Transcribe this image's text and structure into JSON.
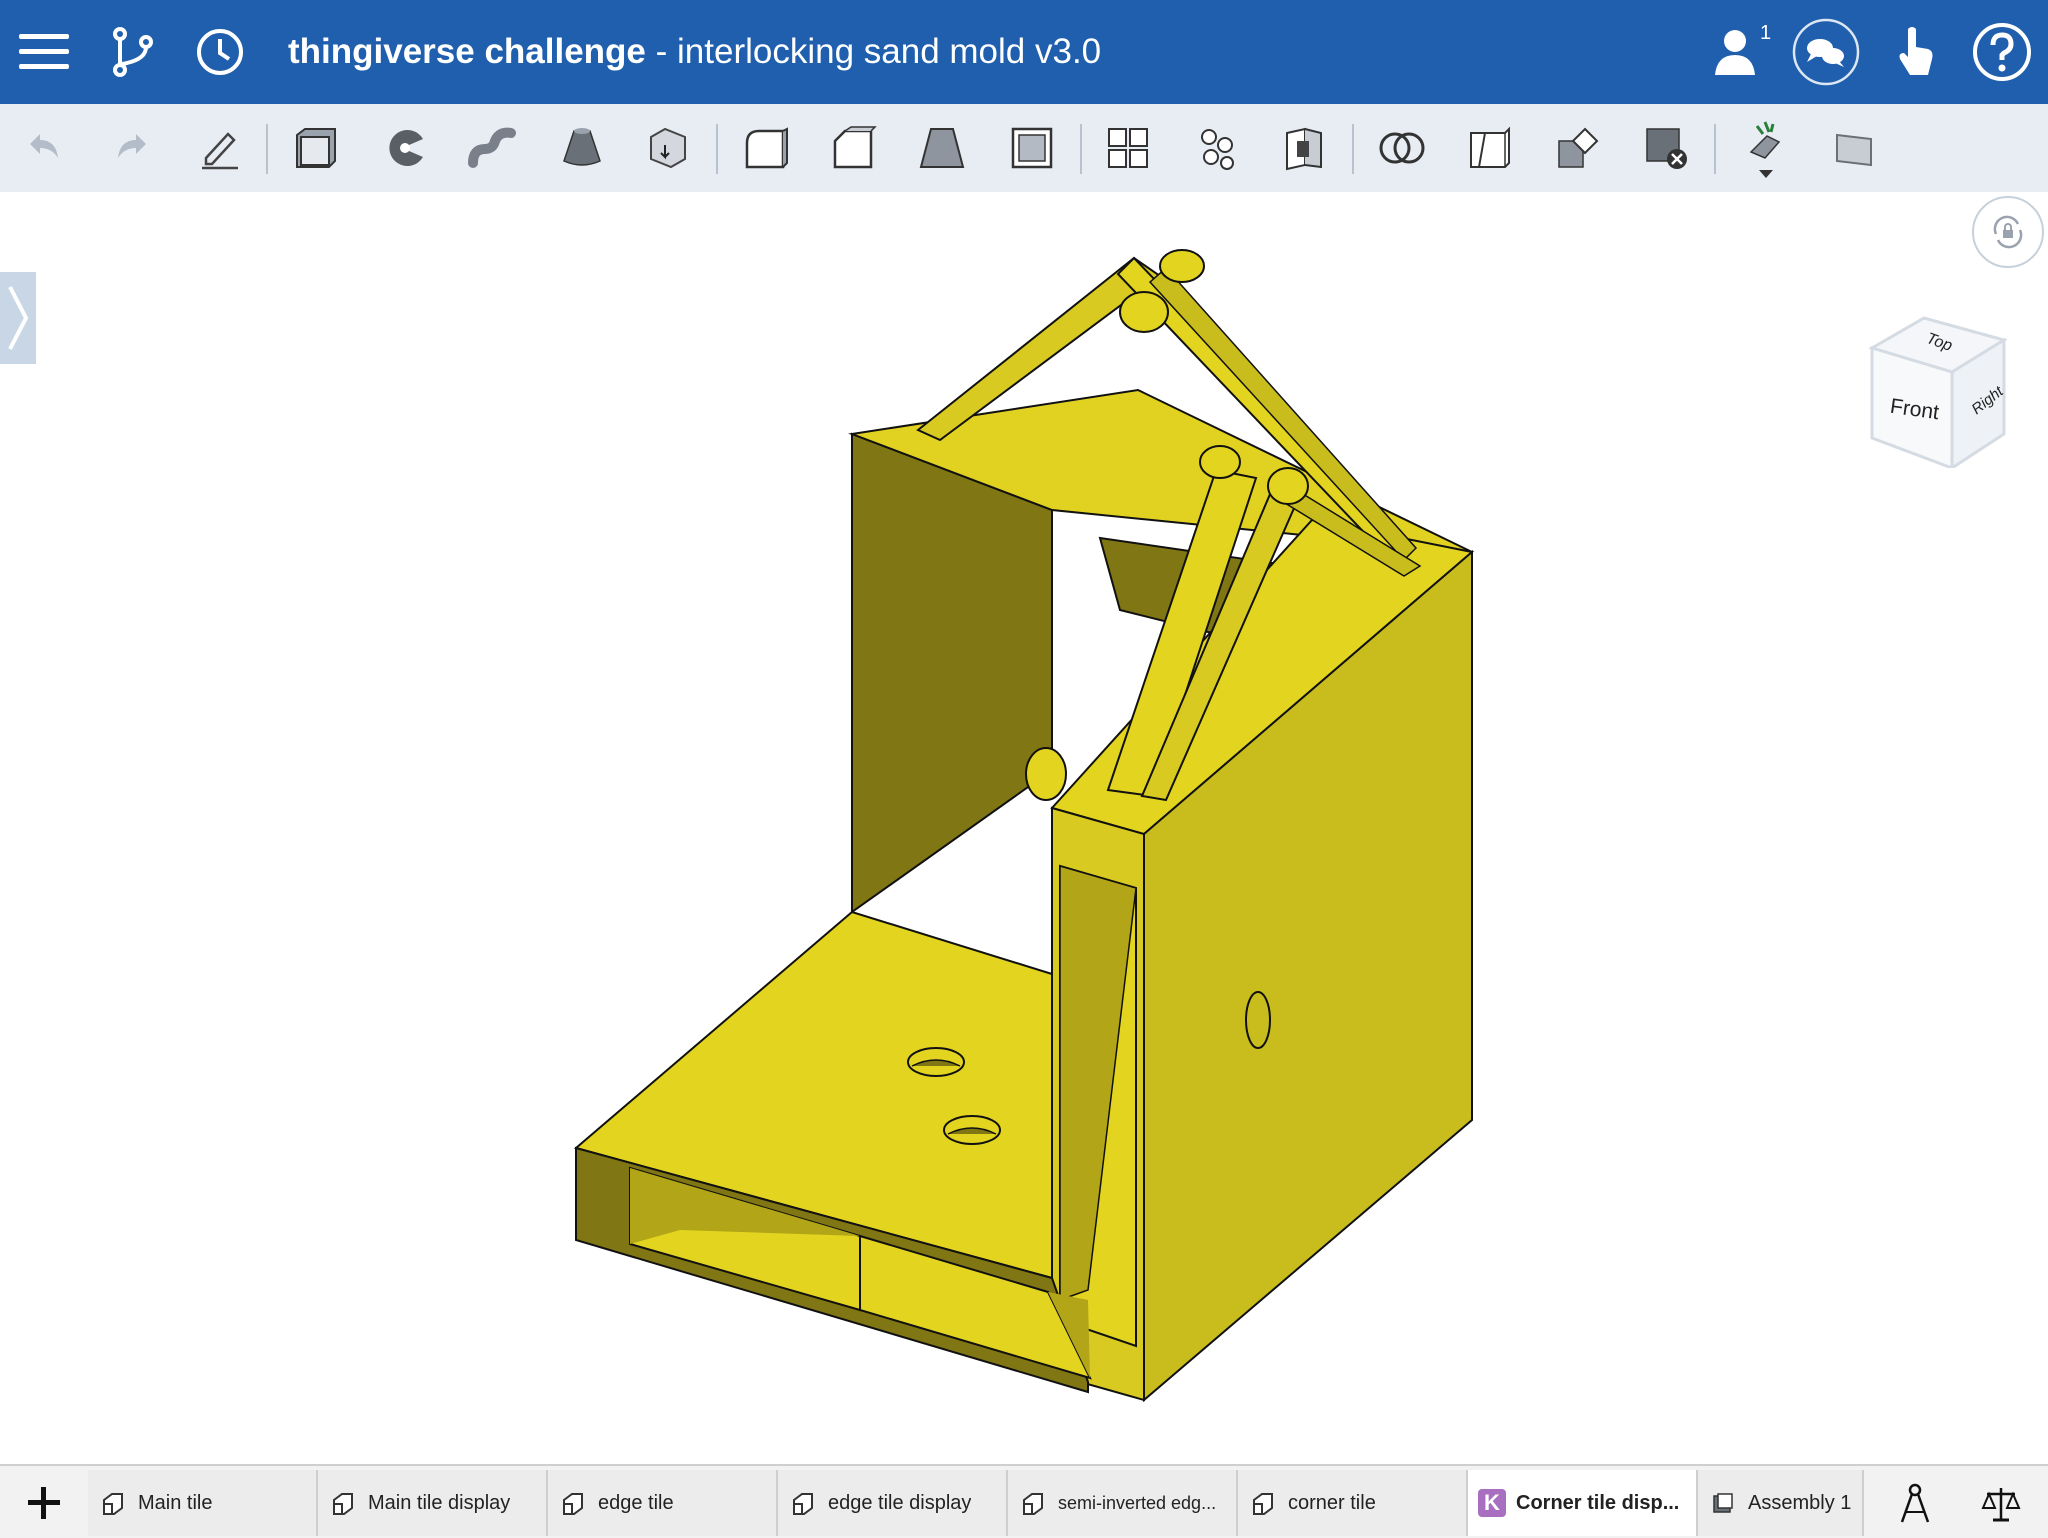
{
  "header": {
    "project_name": "thingiverse challenge",
    "separator": " - ",
    "document_name": "interlocking sand mold v3.0",
    "user_count": "1"
  },
  "icons": {
    "menu": "hamburger-menu-icon",
    "branch": "version-branch-icon",
    "history": "history-clock-icon",
    "users": "user-icon",
    "comments": "comments-icon",
    "touch": "touch-hand-icon",
    "help": "help-icon"
  },
  "toolbar": {
    "tools": [
      "undo",
      "redo",
      "sketch",
      "extrude",
      "revolve",
      "sweep",
      "loft",
      "thicken",
      "fillet",
      "chamfer",
      "draft",
      "shell",
      "pattern",
      "mirror",
      "delete-face",
      "boolean",
      "split",
      "transform",
      "delete-part",
      "custom-feature",
      "plane"
    ]
  },
  "view_cube": {
    "top": "Top",
    "front": "Front",
    "right": "Right"
  },
  "tabs": [
    {
      "label": "Main tile"
    },
    {
      "label": "Main tile display"
    },
    {
      "label": "edge tile"
    },
    {
      "label": "edge tile display"
    },
    {
      "label": "semi-inverted edg..."
    },
    {
      "label": "corner tile"
    },
    {
      "label": "Corner tile disp...",
      "active": true,
      "badge": "K"
    },
    {
      "label": "Assembly 1"
    }
  ],
  "colors": {
    "header_bg": "#1f5fad",
    "toolbar_bg": "#e8edf4",
    "part_face_light": "#e3d420",
    "part_face_mid": "#c9bd1e",
    "part_face_dark": "#807614",
    "badge": "#a86fc1"
  }
}
